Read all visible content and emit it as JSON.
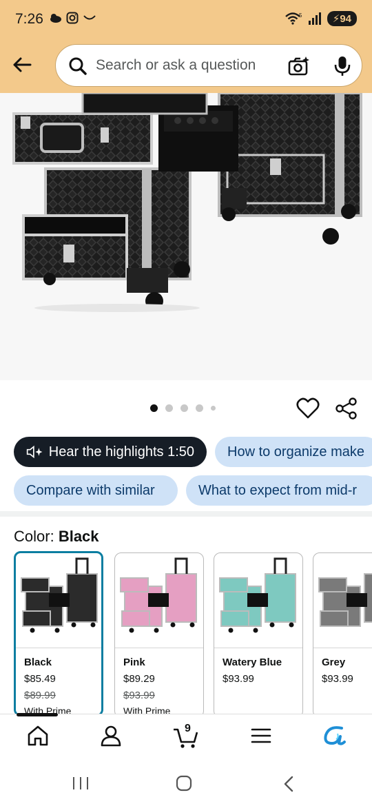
{
  "status_bar": {
    "time": "7:26",
    "battery": "94",
    "wifi_badge": "5"
  },
  "search": {
    "placeholder": "Search or ask a question"
  },
  "gallery": {
    "dots_count": 5,
    "active_index": 0
  },
  "chips": [
    {
      "label": "Hear the highlights 1:50",
      "style": "dark"
    },
    {
      "label": "How to organize make",
      "style": "light"
    },
    {
      "label": "Compare with similar",
      "style": "light"
    },
    {
      "label": "What to expect from mid-r",
      "style": "light"
    }
  ],
  "color": {
    "label": "Color:",
    "selected": "Black",
    "options": [
      {
        "name": "Black",
        "price": "$85.49",
        "list_price": "$89.99",
        "note": "With Prime",
        "color": "#2b2b2b"
      },
      {
        "name": "Pink",
        "price": "$89.29",
        "list_price": "$93.99",
        "note": "With Prime",
        "color": "#e59fc2"
      },
      {
        "name": "Watery Blue",
        "price": "$93.99",
        "list_price": "",
        "note": "",
        "color": "#7ec9c0"
      },
      {
        "name": "Grey",
        "price": "$93.99",
        "list_price": "",
        "note": "",
        "color": "#7a7a7a"
      }
    ]
  },
  "bottom_nav": {
    "cart_count": "9"
  },
  "colors": {
    "header": "#f3c98b",
    "chip_dark": "#161d26",
    "chip_light": "#cfe2f7",
    "selected_border": "#0b7ea1",
    "rufus": "#1f8fd6"
  }
}
